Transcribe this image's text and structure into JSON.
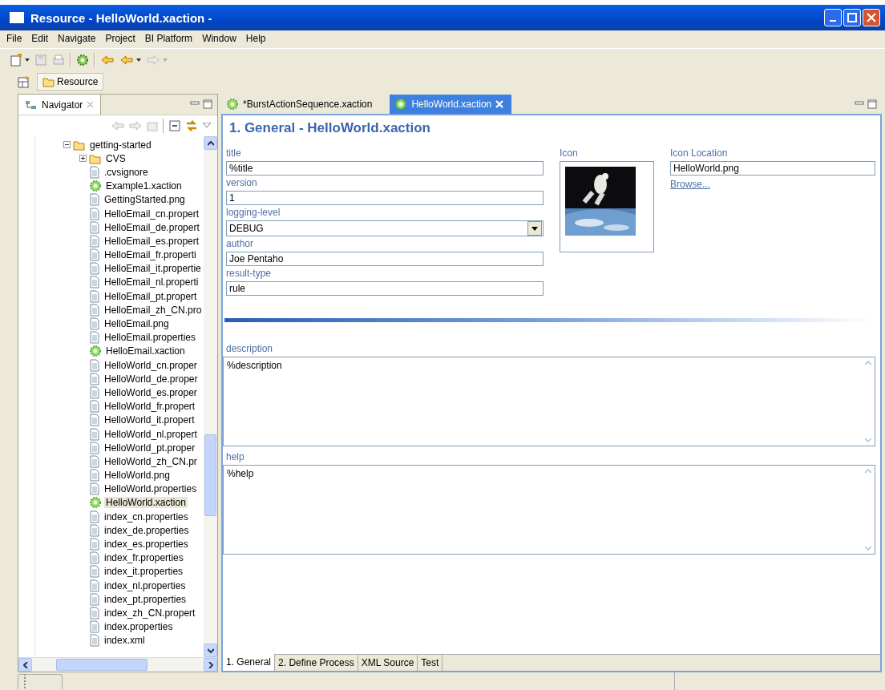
{
  "window": {
    "title": "Resource - HelloWorld.xaction -"
  },
  "menu": [
    "File",
    "Edit",
    "Navigate",
    "Project",
    "BI Platform",
    "Window",
    "Help"
  ],
  "perspective": {
    "label": "Resource",
    "selected": true
  },
  "navigator": {
    "title": "Navigator",
    "tree": [
      {
        "label": "getting-started",
        "kind": "folder",
        "expanded": true,
        "selected": false,
        "children": [
          {
            "label": "CVS",
            "kind": "folder",
            "expanded": false,
            "selected": false
          },
          {
            "label": ".cvsignore",
            "kind": "file",
            "selected": false
          },
          {
            "label": "Example1.xaction",
            "kind": "xaction",
            "selected": false
          },
          {
            "label": "GettingStarted.png",
            "kind": "file",
            "selected": false
          },
          {
            "label": "HelloEmail_cn.propert",
            "kind": "file",
            "selected": false
          },
          {
            "label": "HelloEmail_de.propert",
            "kind": "file",
            "selected": false
          },
          {
            "label": "HelloEmail_es.propert",
            "kind": "file",
            "selected": false
          },
          {
            "label": "HelloEmail_fr.properti",
            "kind": "file",
            "selected": false
          },
          {
            "label": "HelloEmail_it.propertie",
            "kind": "file",
            "selected": false
          },
          {
            "label": "HelloEmail_nl.properti",
            "kind": "file",
            "selected": false
          },
          {
            "label": "HelloEmail_pt.propert",
            "kind": "file",
            "selected": false
          },
          {
            "label": "HelloEmail_zh_CN.pro",
            "kind": "file",
            "selected": false
          },
          {
            "label": "HelloEmail.png",
            "kind": "file",
            "selected": false
          },
          {
            "label": "HelloEmail.properties",
            "kind": "file",
            "selected": false
          },
          {
            "label": "HelloEmail.xaction",
            "kind": "xaction",
            "selected": false
          },
          {
            "label": "HelloWorld_cn.proper",
            "kind": "file",
            "selected": false
          },
          {
            "label": "HelloWorld_de.proper",
            "kind": "file",
            "selected": false
          },
          {
            "label": "HelloWorld_es.proper",
            "kind": "file",
            "selected": false
          },
          {
            "label": "HelloWorld_fr.propert",
            "kind": "file",
            "selected": false
          },
          {
            "label": "HelloWorld_it.propert",
            "kind": "file",
            "selected": false
          },
          {
            "label": "HelloWorld_nl.propert",
            "kind": "file",
            "selected": false
          },
          {
            "label": "HelloWorld_pt.proper",
            "kind": "file",
            "selected": false
          },
          {
            "label": "HelloWorld_zh_CN.pr",
            "kind": "file",
            "selected": false
          },
          {
            "label": "HelloWorld.png",
            "kind": "file",
            "selected": false
          },
          {
            "label": "HelloWorld.properties",
            "kind": "file",
            "selected": false
          },
          {
            "label": "HelloWorld.xaction",
            "kind": "xaction",
            "selected": true
          },
          {
            "label": "index_cn.properties",
            "kind": "file",
            "selected": false
          },
          {
            "label": "index_de.properties",
            "kind": "file",
            "selected": false
          },
          {
            "label": "index_es.properties",
            "kind": "file",
            "selected": false
          },
          {
            "label": "index_fr.properties",
            "kind": "file",
            "selected": false
          },
          {
            "label": "index_it.properties",
            "kind": "file",
            "selected": false
          },
          {
            "label": "index_nl.properties",
            "kind": "file",
            "selected": false
          },
          {
            "label": "index_pt.properties",
            "kind": "file",
            "selected": false
          },
          {
            "label": "index_zh_CN.propert",
            "kind": "file",
            "selected": false
          },
          {
            "label": "index.properties",
            "kind": "file",
            "selected": false
          },
          {
            "label": "index.xml",
            "kind": "file",
            "selected": false
          }
        ]
      }
    ]
  },
  "editor_tabs": [
    {
      "label": "*BurstActionSequence.xaction",
      "selected": false
    },
    {
      "label": "HelloWorld.xaction",
      "selected": true
    }
  ],
  "heading": "1. General - HelloWorld.xaction",
  "fields": [
    {
      "label": "title",
      "kind": "text",
      "value": "%title"
    },
    {
      "label": "version",
      "kind": "text",
      "value": "1"
    },
    {
      "label": "logging-level",
      "kind": "select",
      "value": "DEBUG"
    },
    {
      "label": "author",
      "kind": "text",
      "value": "Joe Pentaho"
    },
    {
      "label": "result-type",
      "kind": "text",
      "value": "rule"
    }
  ],
  "icon": {
    "label": "Icon"
  },
  "icon_location": {
    "label": "Icon Location",
    "value": "HelloWorld.png",
    "link": "Browse..."
  },
  "description": {
    "label": "description",
    "value": "%description"
  },
  "help": {
    "label": "help",
    "value": "%help"
  },
  "page_tabs": [
    {
      "label": "1. General",
      "selected": true
    },
    {
      "label": "2. Define Process",
      "selected": false
    },
    {
      "label": "XML Source",
      "selected": false
    },
    {
      "label": "Test",
      "selected": false
    }
  ]
}
